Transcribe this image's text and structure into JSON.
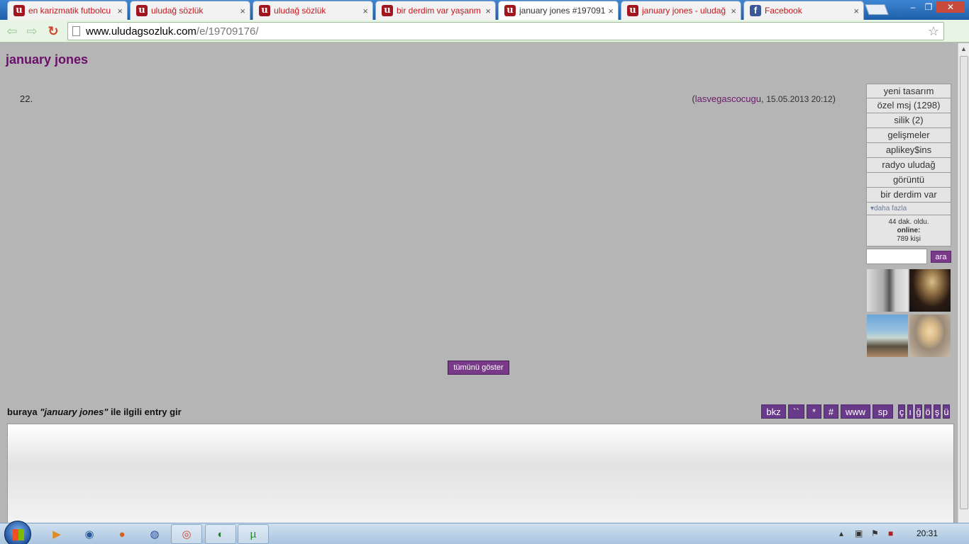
{
  "browser": {
    "tabs": [
      {
        "title": "en karizmatik futbolcu",
        "icon": "uludag-favicon"
      },
      {
        "title": "uludağ sözlük",
        "icon": "uludag-favicon"
      },
      {
        "title": "uludağ sözlük",
        "icon": "uludag-favicon"
      },
      {
        "title": "bir derdim var yaşanm",
        "icon": "uludag-favicon"
      },
      {
        "title": "january jones #197091",
        "icon": "uludag-favicon",
        "active": true
      },
      {
        "title": "january jones - uludağ",
        "icon": "uludag-favicon"
      },
      {
        "title": "Facebook",
        "icon": "facebook-favicon"
      }
    ],
    "url_host": "www.uludagsozluk.com",
    "url_path": "/e/19709176/",
    "favicon_letter": "u",
    "facebook_letter": "f",
    "close_glyph": "×"
  },
  "page": {
    "title": "january jones",
    "entry": {
      "number": "22.",
      "author": "lasvegascocugu",
      "date": "15.05.2013 20:12"
    },
    "show_all_label": "tümünü göster",
    "compose": {
      "prefix": "buraya ",
      "topic": "\"january jones\"",
      "suffix": " ile ilgili entry gir"
    },
    "format_buttons": [
      "bkz",
      "``",
      "*",
      "#",
      "www",
      "sp",
      "ç",
      "ı",
      "ğ",
      "ö",
      "ş",
      "ü"
    ]
  },
  "sidebar": {
    "items": [
      "yeni tasarım",
      "özel msj (1298)",
      "silik (2)",
      "gelişmeler",
      "aplikey$ins",
      "radyo uludağ",
      "görüntü",
      "bir derdim var"
    ],
    "more_label": "daha fazla",
    "online": {
      "ago": "44 dak. oldu.",
      "label": "online:",
      "count": "789 kişi"
    },
    "search_button": "ara"
  },
  "taskbar": {
    "time": "20:31"
  },
  "colors": {
    "accent_purple": "#7a3a8a",
    "title_purple": "#6b0f6b",
    "tab_text_red": "#c4161c",
    "page_bg": "#b5b5b5"
  }
}
